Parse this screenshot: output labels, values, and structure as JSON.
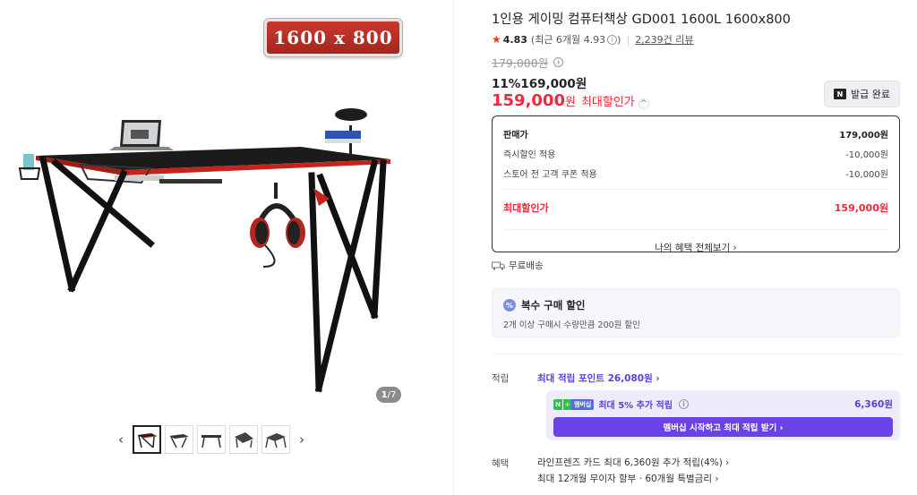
{
  "gallery": {
    "size_badge": "1600 x 800",
    "counter_current": "1",
    "counter_total": "/7",
    "prev_arrow": "‹",
    "next_arrow": "›",
    "thumbnails": [
      "thumb-1",
      "thumb-2",
      "thumb-3",
      "thumb-4",
      "thumb-5"
    ]
  },
  "product": {
    "title": "1인용 게이밍 컴퓨터책상 GD001 1600L 1600x800",
    "rating_score": "4.83",
    "rating_recent": "(최근 6개월 4.93",
    "rating_recent_close": ")",
    "review_count": "2,239건 리뷰",
    "original_price": "179,000원",
    "sale_discount": "11%",
    "sale_price": "169,000원",
    "max_price_num": "159,000",
    "max_price_won": "원",
    "max_price_label": "최대할인가",
    "coupon_button": "발급 완료"
  },
  "price_box": {
    "rows": [
      {
        "label": "판매가",
        "value": "179,000원"
      },
      {
        "label": "즉시할인 적용",
        "value": "-10,000원"
      },
      {
        "label": "스토어 전 고객 쿠폰 적용",
        "value": "-10,000원"
      }
    ],
    "final_label": "최대할인가",
    "final_value": "159,000원",
    "more_link": "나의 혜택 전체보기 ›"
  },
  "shipping": {
    "label": "무료배송"
  },
  "multi_discount": {
    "title": "복수 구매 할인",
    "subtitle": "2개 이상 구매시 수량만큼 200원 할인"
  },
  "points": {
    "label": "적립",
    "max_points": "최대 적립 포인트 26,080원 ›",
    "membership_badge": "멤버십",
    "membership_text": "최대 5% 추가 적립",
    "membership_value": "6,360원",
    "membership_button": "멤버십 시작하고 최대 적립 받기 ›"
  },
  "benefits": {
    "label": "혜택",
    "line1": "라인프렌즈 카드 최대 6,360원 추가 적립(4%) ›",
    "line2": "최대 12개월 무이자 할부 · 60개월 특별금리 ›"
  },
  "colors": {
    "accent_red": "#f0283c",
    "membership_purple": "#6a42e6",
    "naver_green": "#2fbf4f"
  }
}
